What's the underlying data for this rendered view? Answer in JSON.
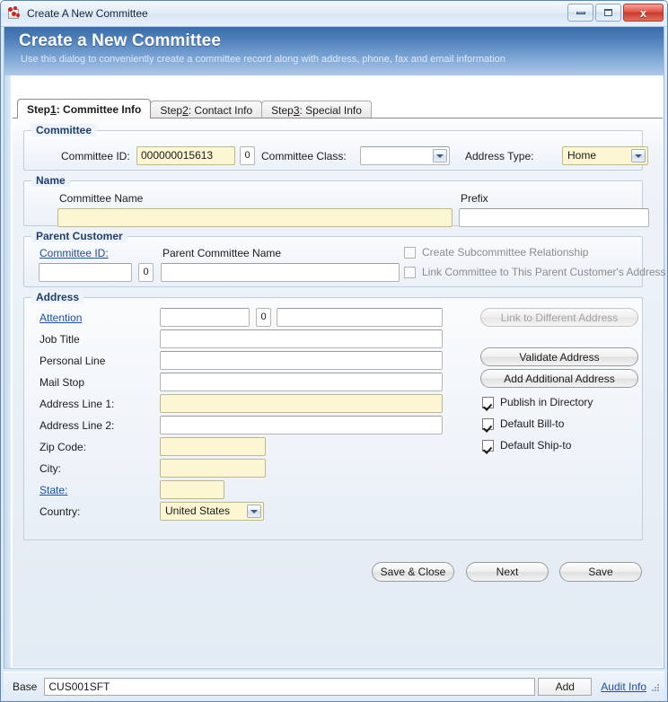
{
  "window": {
    "title": "Create A New Committee",
    "icon": "app-icon",
    "minimize_label": "",
    "maximize_label": "",
    "close_label": "x"
  },
  "banner": {
    "heading": "Create a New Committee",
    "subheading": "Use this dialog to conveniently create a committee record along with address, phone, fax and email information",
    "color_start": "#3a6ca8",
    "color_end": "#afc9e8"
  },
  "tabs": [
    {
      "pre": "Step ",
      "accel": "1",
      "post": ": Committee Info",
      "active": true
    },
    {
      "pre": "Step ",
      "accel": "2",
      "post": ": Contact Info",
      "active": false
    },
    {
      "pre": "Step ",
      "accel": "3",
      "post": ": Special Info",
      "active": false
    }
  ],
  "committee_group": {
    "legend": "Committee",
    "committee_id_label": "Committee ID:",
    "committee_id_value": "000000015613",
    "committee_id_seq": "0",
    "committee_class_label": "Committee Class:",
    "committee_class_value": "",
    "address_type_label": "Address Type:",
    "address_type_value": "Home"
  },
  "name_group": {
    "legend": "Name",
    "committee_name_label": "Committee Name",
    "committee_name_value": "",
    "prefix_label": "Prefix",
    "prefix_value": ""
  },
  "parent_group": {
    "legend": "Parent Customer",
    "committee_id_label": "Committee ID:",
    "committee_id_value": "",
    "committee_id_seq": "0",
    "parent_name_label": "Parent Committee Name",
    "parent_name_value": "",
    "create_subcommittee_label": "Create Subcommittee Relationship",
    "link_parent_address_label": "Link Committee to This Parent Customer's Address"
  },
  "address_group": {
    "legend": "Address",
    "attention_label": "Attention",
    "attention_value": "",
    "attention_seq": "0",
    "attention_value2": "",
    "job_title_label": "Job Title",
    "job_title_value": "",
    "personal_line_label": "Personal Line",
    "personal_line_value": "",
    "mail_stop_label": "Mail Stop",
    "mail_stop_value": "",
    "address_line1_label": "Address Line 1:",
    "address_line1_value": "",
    "address_line2_label": "Address Line 2:",
    "address_line2_value": "",
    "zip_label": "Zip Code:",
    "zip_value": "",
    "city_label": "City:",
    "city_value": "",
    "state_label": "State:",
    "state_value": "",
    "country_label": "Country:",
    "country_value": "United States",
    "link_different_address_button": "Link to Different Address",
    "validate_address_button": "Validate Address",
    "add_additional_address_button": "Add Additional Address",
    "publish_directory_label": "Publish in Directory",
    "default_billto_label": "Default Bill-to",
    "default_shipto_label": "Default Ship-to"
  },
  "footer": {
    "save_close_button": "Save & Close",
    "next_button": "Next",
    "save_button": "Save"
  },
  "statusbar": {
    "base_label": "Base",
    "base_value": "CUS001SFT",
    "add_button": "Add",
    "audit_link": "Audit Info"
  }
}
